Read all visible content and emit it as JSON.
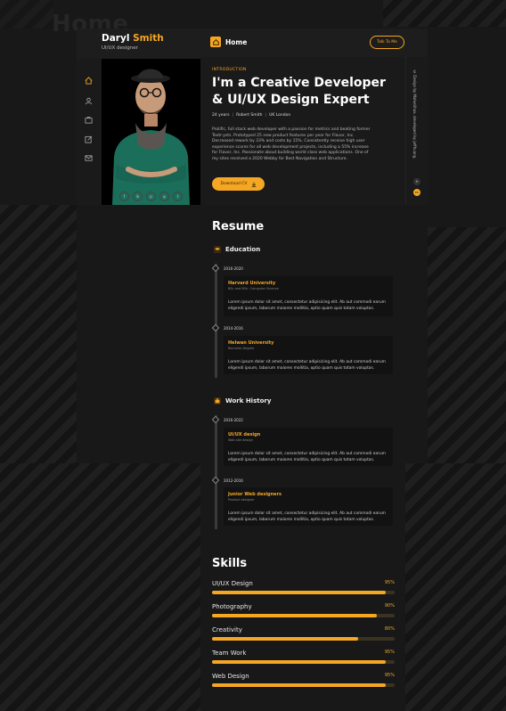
{
  "background": {
    "watermark": "Home"
  },
  "profile": {
    "first_name": "Daryl",
    "last_name": "Smith",
    "role": "UI/UX designer"
  },
  "topbar": {
    "page_title": "Home",
    "cta_label": "Talk To Me"
  },
  "rail_icons": [
    "home-icon",
    "user-icon",
    "briefcase-icon",
    "edit-icon",
    "mail-icon"
  ],
  "socials": [
    {
      "icon": "facebook-icon",
      "glyph": "f"
    },
    {
      "icon": "linkedin-icon",
      "glyph": "in"
    },
    {
      "icon": "pinterest-icon",
      "glyph": "p"
    },
    {
      "icon": "instagram-icon",
      "glyph": "◎"
    },
    {
      "icon": "twitter-icon",
      "glyph": "t"
    }
  ],
  "intro": {
    "eyebrow": "INTRODUCTION",
    "headline": "I'm a Creative Developer & UI/UX Design Expert",
    "age": "24 years",
    "name": "Robert Smith",
    "location": "UK London",
    "bio": "Prolific, full stack web developer with a passion for metrics and beating former Textr-ysts. Prototyped 25 new product features per year for Flavor, Inc. Decreased rework by 33% and costs by 15%. Consistently receive high user experience scores for all web development projects, including a 55% increase for Flavor, Inc. Passionate about building world class web applications. One of my sites received a 2020 Webby for Best Navigation and Structure.",
    "download_label": "Download CV"
  },
  "right_rail": {
    "credit": "© Design by Mahedihax. developed by jeffhuang.",
    "lang_options": [
      "fr",
      "en"
    ]
  },
  "resume": {
    "title": "Resume",
    "education": {
      "heading": "Education",
      "entries": [
        {
          "years": "2016-2020",
          "school": "Harvard University",
          "degree": "BSc and MSc. Computer Science",
          "text": "Lorem ipsum dolor sit amet, consectetur adipisicing elit. Ab aut commodi earum eligendi ipsum, laborum maiores mollitia, optio quam quis totam voluptas."
        },
        {
          "years": "2014-2016",
          "school": "Helwan University",
          "degree": "Bachelor Degree",
          "text": "Lorem ipsum dolor sit amet, consectetur adipisicing elit. Ab aut commodi earum eligendi ipsum, laborum maiores mollitia, optio quam quis totam voluptas."
        }
      ]
    },
    "work": {
      "heading": "Work History",
      "entries": [
        {
          "years": "2016-2022",
          "title": "UI/UX design",
          "company": "Web site design",
          "text": "Lorem ipsum dolor sit amet, consectetur adipisicing elit. Ab aut commodi earum eligendi ipsum, laborum maiores mollitia, optio quam quis totam voluptas."
        },
        {
          "years": "2012-2016",
          "title": "Junior Web designers",
          "company": "Product designer",
          "text": "Lorem ipsum dolor sit amet, consectetur adipisicing elit. Ab aut commodi earum eligendi ipsum, laborum maiores mollitia, optio quam quis totam voluptas."
        }
      ]
    }
  },
  "skills": {
    "title": "Skills",
    "items": [
      {
        "name": "UI/UX Design",
        "label": "95%",
        "percent": 95
      },
      {
        "name": "Photography",
        "label": "90%",
        "percent": 90
      },
      {
        "name": "Creativity",
        "label": "80%",
        "percent": 80
      },
      {
        "name": "Team Work",
        "label": "95%",
        "percent": 95
      },
      {
        "name": "Web Design",
        "label": "95%",
        "percent": 95
      }
    ]
  },
  "colors": {
    "accent": "#f5a623",
    "background": "#181818",
    "panel": "#1a1a1a"
  }
}
